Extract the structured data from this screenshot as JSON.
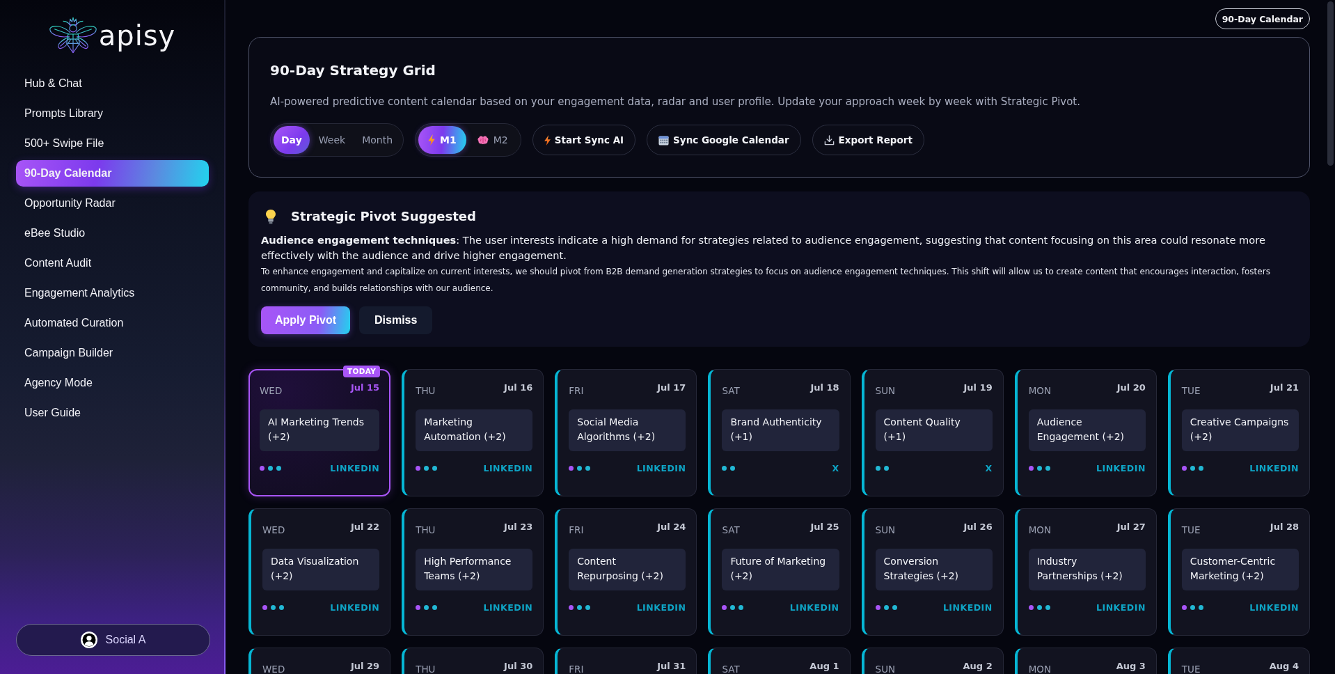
{
  "sidebar": {
    "logo": "apisy",
    "items": [
      {
        "label": "Hub & Chat",
        "selected": false
      },
      {
        "label": "Prompts Library",
        "selected": false
      },
      {
        "label": "500+ Swipe File",
        "selected": false
      },
      {
        "label": "90-Day Calendar",
        "selected": true
      },
      {
        "label": "Opportunity Radar",
        "selected": false
      },
      {
        "label": "eBee Studio",
        "selected": false
      },
      {
        "label": "Content Audit",
        "selected": false
      },
      {
        "label": "Engagement Analytics",
        "selected": false
      },
      {
        "label": "Automated Curation",
        "selected": false
      },
      {
        "label": "Campaign Builder",
        "selected": false
      },
      {
        "label": "Agency Mode",
        "selected": false
      },
      {
        "label": "User Guide",
        "selected": false
      }
    ],
    "account": "Social A"
  },
  "page_badge": "90-Day Calendar",
  "header": {
    "title": "90-Day Strategy Grid",
    "description": "AI-powered predictive content calendar based on your engagement data, radar and user profile. Update your approach week by week with Strategic Pivot.",
    "view_modes": [
      {
        "label": "Day",
        "selected": true
      },
      {
        "label": "Week",
        "selected": false
      },
      {
        "label": "Month",
        "selected": false
      }
    ],
    "models": [
      {
        "label": "M1",
        "selected": true
      },
      {
        "label": "M2",
        "selected": false
      }
    ],
    "actions": [
      {
        "label": "Start Sync AI"
      },
      {
        "label": "Sync Google Calendar"
      },
      {
        "label": "Export Report"
      }
    ]
  },
  "pivot": {
    "title": "Strategic Pivot Suggested",
    "summary": "**Audience engagement techniques**: The user interests indicate a high demand for strategies related to audience engagement, suggesting that content focusing on this area could resonate more effectively with the audience and drive higher engagement.",
    "detail": "To enhance engagement and capitalize on current interests, we should pivot from B2B demand generation strategies to focus on audience engagement techniques. This shift will allow us to create content that encourages interaction, fosters community, and builds relationships with our audience.",
    "buttons": [
      {
        "label": "Apply Pivot",
        "kind": "primary"
      },
      {
        "label": "Dismiss",
        "kind": "secondary"
      }
    ]
  },
  "calendar": {
    "today_label": "TODAY",
    "days": [
      {
        "weekday": "WED",
        "date": "Jul 15",
        "today": true,
        "topic": "AI Marketing Trends (+2)",
        "dots": [
          {
            "color": "#a855f7"
          },
          {
            "color": "#22b8d4"
          },
          {
            "color": "#22b8d4"
          }
        ],
        "platform": "LINKEDIN"
      },
      {
        "weekday": "THU",
        "date": "Jul 16",
        "today": false,
        "topic": "Marketing Automation (+2)",
        "dots": [
          {
            "color": "#a855f7"
          },
          {
            "color": "#22b8d4"
          },
          {
            "color": "#22b8d4"
          }
        ],
        "platform": "LINKEDIN"
      },
      {
        "weekday": "FRI",
        "date": "Jul 17",
        "today": false,
        "topic": "Social Media Algorithms (+2)",
        "dots": [
          {
            "color": "#a855f7"
          },
          {
            "color": "#22b8d4"
          },
          {
            "color": "#22b8d4"
          }
        ],
        "platform": "LINKEDIN"
      },
      {
        "weekday": "SAT",
        "date": "Jul 18",
        "today": false,
        "topic": "Brand Authenticity (+1)",
        "dots": [
          {
            "color": "#22b8d4"
          },
          {
            "color": "#22b8d4"
          }
        ],
        "platform": "X"
      },
      {
        "weekday": "SUN",
        "date": "Jul 19",
        "today": false,
        "topic": "Content Quality (+1)",
        "dots": [
          {
            "color": "#22b8d4"
          },
          {
            "color": "#22b8d4"
          }
        ],
        "platform": "X"
      },
      {
        "weekday": "MON",
        "date": "Jul 20",
        "today": false,
        "topic": "Audience Engagement (+2)",
        "dots": [
          {
            "color": "#a855f7"
          },
          {
            "color": "#22b8d4"
          },
          {
            "color": "#22b8d4"
          }
        ],
        "platform": "LINKEDIN"
      },
      {
        "weekday": "TUE",
        "date": "Jul 21",
        "today": false,
        "topic": "Creative Campaigns (+2)",
        "dots": [
          {
            "color": "#a855f7"
          },
          {
            "color": "#22b8d4"
          },
          {
            "color": "#22b8d4"
          }
        ],
        "platform": "LINKEDIN"
      },
      {
        "weekday": "WED",
        "date": "Jul 22",
        "today": false,
        "topic": "Data Visualization (+2)",
        "dots": [
          {
            "color": "#a855f7"
          },
          {
            "color": "#22b8d4"
          },
          {
            "color": "#22b8d4"
          }
        ],
        "platform": "LINKEDIN"
      },
      {
        "weekday": "THU",
        "date": "Jul 23",
        "today": false,
        "topic": "High Performance Teams (+2)",
        "dots": [
          {
            "color": "#a855f7"
          },
          {
            "color": "#22b8d4"
          },
          {
            "color": "#22b8d4"
          }
        ],
        "platform": "LINKEDIN"
      },
      {
        "weekday": "FRI",
        "date": "Jul 24",
        "today": false,
        "topic": "Content Repurposing (+2)",
        "dots": [
          {
            "color": "#a855f7"
          },
          {
            "color": "#22b8d4"
          },
          {
            "color": "#22b8d4"
          }
        ],
        "platform": "LINKEDIN"
      },
      {
        "weekday": "SAT",
        "date": "Jul 25",
        "today": false,
        "topic": "Future of Marketing (+2)",
        "dots": [
          {
            "color": "#a855f7"
          },
          {
            "color": "#22b8d4"
          },
          {
            "color": "#22b8d4"
          }
        ],
        "platform": "LINKEDIN"
      },
      {
        "weekday": "SUN",
        "date": "Jul 26",
        "today": false,
        "topic": "Conversion Strategies (+2)",
        "dots": [
          {
            "color": "#a855f7"
          },
          {
            "color": "#22b8d4"
          },
          {
            "color": "#22b8d4"
          }
        ],
        "platform": "LINKEDIN"
      },
      {
        "weekday": "MON",
        "date": "Jul 27",
        "today": false,
        "topic": "Industry Partnerships (+2)",
        "dots": [
          {
            "color": "#a855f7"
          },
          {
            "color": "#22b8d4"
          },
          {
            "color": "#22b8d4"
          }
        ],
        "platform": "LINKEDIN"
      },
      {
        "weekday": "TUE",
        "date": "Jul 28",
        "today": false,
        "topic": "Customer-Centric Marketing (+2)",
        "dots": [
          {
            "color": "#a855f7"
          },
          {
            "color": "#22b8d4"
          },
          {
            "color": "#22b8d4"
          }
        ],
        "platform": "LINKEDIN"
      },
      {
        "weekday": "WED",
        "date": "Jul 29",
        "today": false
      },
      {
        "weekday": "THU",
        "date": "Jul 30",
        "today": false
      },
      {
        "weekday": "FRI",
        "date": "Jul 31",
        "today": false
      },
      {
        "weekday": "SAT",
        "date": "Aug 1",
        "today": false
      },
      {
        "weekday": "SUN",
        "date": "Aug 2",
        "today": false
      },
      {
        "weekday": "MON",
        "date": "Aug 3",
        "today": false
      },
      {
        "weekday": "TUE",
        "date": "Aug 4",
        "today": false
      }
    ]
  }
}
